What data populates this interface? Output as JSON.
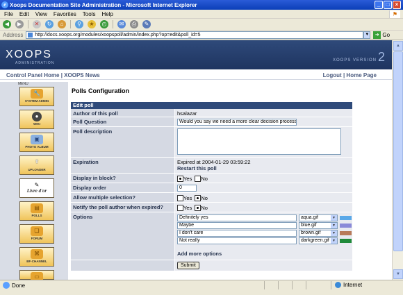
{
  "window": {
    "title": "Xoops Documentation Site Administration - Microsoft Internet Explorer",
    "buttons": [
      "_",
      "□",
      "×"
    ]
  },
  "menubar": {
    "items": [
      "File",
      "Edit",
      "View",
      "Favorites",
      "Tools",
      "Help"
    ]
  },
  "address": {
    "label": "Address",
    "url": "http://docs.xoops.org/modules/xoopspoll/admin/index.php?op=edit&poll_id=5",
    "go_label": "Go"
  },
  "banner": {
    "logo": "XOOPS",
    "logo_sub": "ADMINISTRATION",
    "version_label": "XOOPS VERSION",
    "version_number": "2"
  },
  "nav": {
    "left": [
      "Control Panel Home",
      "XOOPS News"
    ],
    "right": [
      "Logout",
      "Home Page"
    ],
    "separator": "|"
  },
  "sidebar": {
    "title": "MENU",
    "modules": [
      {
        "label": "SYSTEM ADMIN",
        "icon": "wrench-icon"
      },
      {
        "label": "WIKI",
        "icon": "globe-icon"
      },
      {
        "label": "PHOTO ALBUM",
        "icon": "photo-icon"
      },
      {
        "label": "UPLOADER",
        "icon": "upload-icon"
      },
      {
        "label": "Livre d'or",
        "icon": "book-icon"
      },
      {
        "label": "POLLS",
        "icon": "chart-icon"
      },
      {
        "label": "FORUM",
        "icon": "forum-icon"
      },
      {
        "label": "BF-CHANNEL",
        "icon": "channel-icon"
      },
      {
        "label": "",
        "icon": "folder-icon"
      }
    ]
  },
  "page": {
    "title": "Polls Configuration",
    "form_header": "Edit poll"
  },
  "form": {
    "author_label": "Author of this poll",
    "author_value": "hsalazar",
    "question_label": "Poll Question",
    "question_value": "Would you say we need a more clear decision process",
    "description_label": "Poll description",
    "description_value": "",
    "expiration_label": "Expiration",
    "expiration_value": "Expired at 2004-01-29 03:59:22",
    "restart_label": "Restart this poll",
    "display_block_label": "Display in block?",
    "display_order_label": "Display order",
    "display_order_value": "0",
    "multiple_label": "Allow multiple selection?",
    "notify_label": "Notify the poll author when expired?",
    "yes": "Yes",
    "no": "No",
    "options_label": "Options",
    "add_more": "Add more options",
    "submit": "Submit"
  },
  "radio_state": {
    "display_in_block": "Yes",
    "allow_multiple": "No",
    "notify_author": "No"
  },
  "options": [
    {
      "text": "Definitely yes",
      "color_file": "aqua.gif",
      "color": "#5aa8e8"
    },
    {
      "text": "Maybe",
      "color_file": "blue.gif",
      "color": "#8a8ad8"
    },
    {
      "text": "I don't care",
      "color_file": "brown.gif",
      "color": "#b87a5a"
    },
    {
      "text": "Not really",
      "color_file": "darkgreen.gif",
      "color": "#1f8a3a"
    }
  ],
  "status": {
    "left": "Done",
    "zone": "Internet"
  },
  "colors": {
    "banner": "#2f4a7a",
    "label_bg": "#d5d9e3",
    "value_bg": "#e8eaf0",
    "nav_text": "#4a5a7e"
  }
}
